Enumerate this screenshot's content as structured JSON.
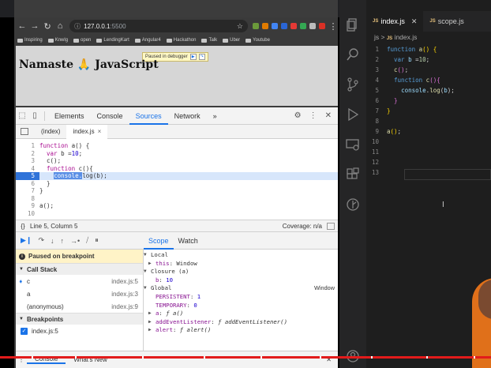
{
  "browser": {
    "url_host": "127.0.0.1",
    "url_port": ":5500",
    "bookmarks": [
      "Inspiring",
      "Knwlg",
      "open",
      "LendingKart",
      "Angular4",
      "Hackathon",
      "Talk",
      "Uber",
      "Youtube"
    ],
    "ext_colors": [
      "#6b9a3a",
      "#e07b00",
      "#4285f4",
      "#2a66d6",
      "#e53935",
      "#34a853",
      "#bbbbbb",
      "#d93025"
    ]
  },
  "page": {
    "title": "Namaste 🙏 JavaScript",
    "paused_badge": "Paused in debugger"
  },
  "devtools": {
    "tabs": [
      "Elements",
      "Console",
      "Sources",
      "Network"
    ],
    "active_tab": "Sources",
    "more": "»",
    "file_tabs": [
      "(index)",
      "index.js"
    ],
    "code_lines": [
      {
        "n": "1",
        "t": "function a() {"
      },
      {
        "n": "2",
        "t": "  var b =10;"
      },
      {
        "n": "3",
        "t": "  c();"
      },
      {
        "n": "4",
        "t": "  function c(){"
      },
      {
        "n": "5",
        "t": "    console.log(b);"
      },
      {
        "n": "6",
        "t": "  }"
      },
      {
        "n": "7",
        "t": "}"
      },
      {
        "n": "8",
        "t": ""
      },
      {
        "n": "9",
        "t": "a();"
      },
      {
        "n": "10",
        "t": ""
      }
    ],
    "status": {
      "position": "Line 5, Column 5",
      "coverage": "Coverage: n/a",
      "brace": "{}"
    },
    "paused_label": "Paused on breakpoint",
    "call_stack_label": "Call Stack",
    "frames": [
      {
        "name": "c",
        "loc": "index.js:5"
      },
      {
        "name": "a",
        "loc": "index.js:3"
      },
      {
        "name": "(anonymous)",
        "loc": "index.js:9"
      }
    ],
    "breakpoints_label": "Breakpoints",
    "breakpoint": "index.js:5",
    "scope_tabs": [
      "Scope",
      "Watch"
    ],
    "scope": {
      "local": "Local",
      "this_key": "this",
      "this_val": "Window",
      "closure": "Closure (a)",
      "b_key": "b",
      "b_val": "10",
      "global": "Global",
      "global_val": "Window",
      "persistent_key": "PERSISTENT",
      "persistent_val": "1",
      "temporary_key": "TEMPORARY",
      "temporary_val": "0",
      "a_key": "a",
      "a_val": "ƒ a()",
      "ael_key": "addEventListener",
      "ael_val": "ƒ addEventListener()",
      "alert_key": "alert",
      "alert_val": "ƒ alert()"
    },
    "drawer_tabs": [
      "Console",
      "What's New"
    ]
  },
  "vscode": {
    "tabs": [
      "index.js",
      "scope.js"
    ],
    "breadcrumb_folder": "js",
    "breadcrumb_file": "index.js",
    "lines": [
      {
        "n": "1"
      },
      {
        "n": "2"
      },
      {
        "n": "3"
      },
      {
        "n": "4"
      },
      {
        "n": "5"
      },
      {
        "n": "6"
      },
      {
        "n": "7"
      },
      {
        "n": "8"
      },
      {
        "n": "9"
      },
      {
        "n": "10"
      },
      {
        "n": "11"
      },
      {
        "n": "12"
      },
      {
        "n": "13"
      }
    ]
  }
}
